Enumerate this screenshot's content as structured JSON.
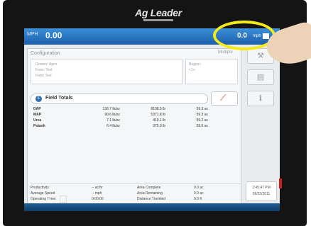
{
  "device": {
    "brand": "Ag Leader"
  },
  "topbar": {
    "left_label": "MPH",
    "left_value": "0.00",
    "right_value": "0.0",
    "right_unit": "mph"
  },
  "configuration": {
    "title": "Configuration",
    "mode": "Multiple",
    "lines": [
      "Grower: Agco",
      "Farm:  Test",
      "Field:  Test"
    ],
    "region_label": "Region:",
    "region_value": "<1>"
  },
  "field_totals": {
    "title": "Field Totals",
    "rows": [
      {
        "product": "DAP",
        "rate": "136.7 lb/ac",
        "total": "8108.5 lb",
        "area": "59.3 ac"
      },
      {
        "product": "MAP",
        "rate": "90.6 lb/ac",
        "total": "5371.8 lb",
        "area": "59.3 ac"
      },
      {
        "product": "Urea",
        "rate": "7.1 lb/ac",
        "total": "419.1 lb",
        "area": "59.2 ac"
      },
      {
        "product": "Potash",
        "rate": "6.4 lb/ac",
        "total": "375.0 lb",
        "area": "59.0 ac"
      }
    ]
  },
  "summary": {
    "rows": [
      {
        "label": "Productivity",
        "value": "-- ac/hr",
        "label2": "Area Complete",
        "value2": "0.0 ac"
      },
      {
        "label": "Average Speed",
        "value": "-- mph",
        "label2": "Area Remaining",
        "value2": "0.0 ac"
      },
      {
        "label": "Operating Timer",
        "value": "0:00:00",
        "label2": "Distance Traveled",
        "value2": "0.0 ft"
      }
    ]
  },
  "clock": {
    "time": "1:45:47 PM",
    "date": "08/23/2011"
  },
  "colors": {
    "topbar": "#1d5faa",
    "highlight": "#f3ea18",
    "bottombar": "#103c66"
  }
}
